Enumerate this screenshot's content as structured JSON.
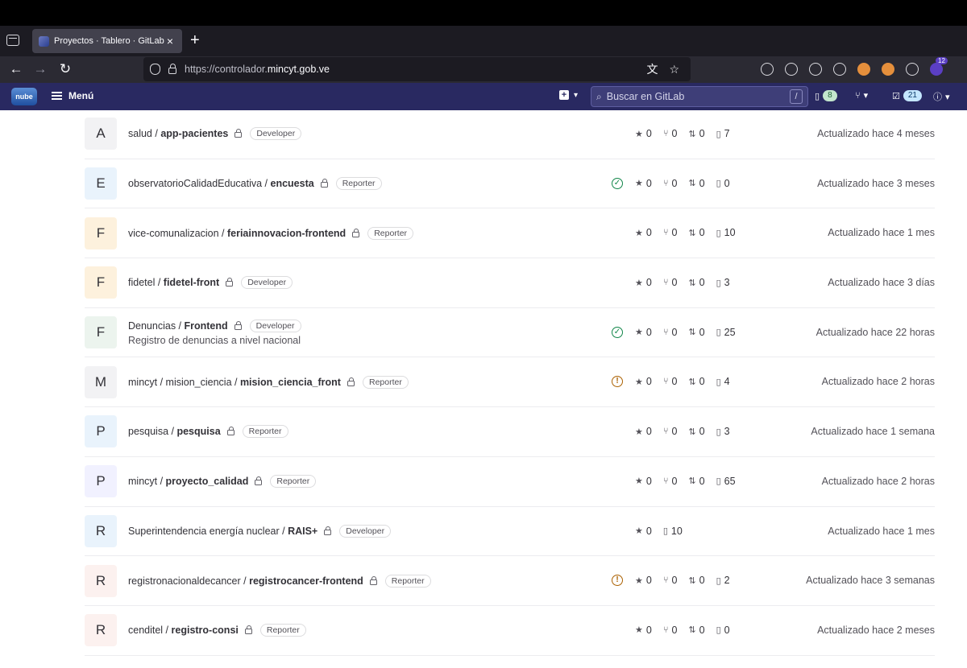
{
  "browser": {
    "tab_title": "Proyectos · Tablero · GitLab",
    "url_prefix": "https://controlador.",
    "url_domain": "mincyt.gob.ve",
    "extension_badge": "12"
  },
  "header": {
    "logo_text": "nube",
    "menu_label": "Menú",
    "search_placeholder": "Buscar en GitLab",
    "search_shortcut": "/",
    "issues_count": "8",
    "todos_count": "21"
  },
  "colors": {
    "gitlab_header": "#292961",
    "status_ok": "#108548",
    "status_warn": "#ab6100"
  },
  "projects": [
    {
      "avatar": "A",
      "avatar_color": "#f2f2f4",
      "namespace": "salud / ",
      "name": "app-pacientes",
      "role": "Developer",
      "desc": "",
      "status": "",
      "stars": "0",
      "forks": "0",
      "mrs": "0",
      "issues": "7",
      "updated": "Actualizado hace 4 meses"
    },
    {
      "avatar": "E",
      "avatar_color": "#e9f3fc",
      "namespace": "observatorioCalidadEducativa / ",
      "name": "encuesta",
      "role": "Reporter",
      "desc": "",
      "status": "ok",
      "stars": "0",
      "forks": "0",
      "mrs": "0",
      "issues": "0",
      "updated": "Actualizado hace 3 meses"
    },
    {
      "avatar": "F",
      "avatar_color": "#fdf1dd",
      "namespace": "vice-comunalizacion / ",
      "name": "feriainnovacion-frontend",
      "role": "Reporter",
      "desc": "",
      "status": "",
      "stars": "0",
      "forks": "0",
      "mrs": "0",
      "issues": "10",
      "updated": "Actualizado hace 1 mes"
    },
    {
      "avatar": "F",
      "avatar_color": "#fdf1dd",
      "namespace": "fidetel / ",
      "name": "fidetel-front",
      "role": "Developer",
      "desc": "",
      "status": "",
      "stars": "0",
      "forks": "0",
      "mrs": "0",
      "issues": "3",
      "updated": "Actualizado hace 3 días"
    },
    {
      "avatar": "F",
      "avatar_color": "#ecf4ee",
      "namespace": "Denuncias / ",
      "name": "Frontend",
      "role": "Developer",
      "desc": "Registro de denuncias a nivel nacional",
      "status": "ok",
      "stars": "0",
      "forks": "0",
      "mrs": "0",
      "issues": "25",
      "updated": "Actualizado hace 22 horas"
    },
    {
      "avatar": "M",
      "avatar_color": "#f2f2f4",
      "namespace": "mincyt / mision_ciencia / ",
      "name": "mision_ciencia_front",
      "role": "Reporter",
      "desc": "",
      "status": "warn",
      "stars": "0",
      "forks": "0",
      "mrs": "0",
      "issues": "4",
      "updated": "Actualizado hace 2 horas"
    },
    {
      "avatar": "P",
      "avatar_color": "#e9f3fc",
      "namespace": "pesquisa / ",
      "name": "pesquisa",
      "role": "Reporter",
      "desc": "",
      "status": "",
      "stars": "0",
      "forks": "0",
      "mrs": "0",
      "issues": "3",
      "updated": "Actualizado hace 1 semana"
    },
    {
      "avatar": "P",
      "avatar_color": "#f1f1ff",
      "namespace": "mincyt / ",
      "name": "proyecto_calidad",
      "role": "Reporter",
      "desc": "",
      "status": "",
      "stars": "0",
      "forks": "0",
      "mrs": "0",
      "issues": "65",
      "updated": "Actualizado hace 2 horas"
    },
    {
      "avatar": "R",
      "avatar_color": "#e9f3fc",
      "namespace": "Superintendencia energía nuclear / ",
      "name": "RAIS+",
      "role": "Developer",
      "desc": "",
      "status": "",
      "stars": "0",
      "forks": "",
      "mrs": "",
      "issues": "10",
      "updated": "Actualizado hace 1 mes"
    },
    {
      "avatar": "R",
      "avatar_color": "#fcf1ef",
      "namespace": "registronacionaldecancer / ",
      "name": "registrocancer-frontend",
      "role": "Reporter",
      "desc": "",
      "status": "warn",
      "stars": "0",
      "forks": "0",
      "mrs": "0",
      "issues": "2",
      "updated": "Actualizado hace 3 semanas"
    },
    {
      "avatar": "R",
      "avatar_color": "#fcf1ef",
      "namespace": "cenditel / ",
      "name": "registro-consi",
      "role": "Reporter",
      "desc": "",
      "status": "",
      "stars": "0",
      "forks": "0",
      "mrs": "0",
      "issues": "0",
      "updated": "Actualizado hace 2 meses"
    }
  ]
}
